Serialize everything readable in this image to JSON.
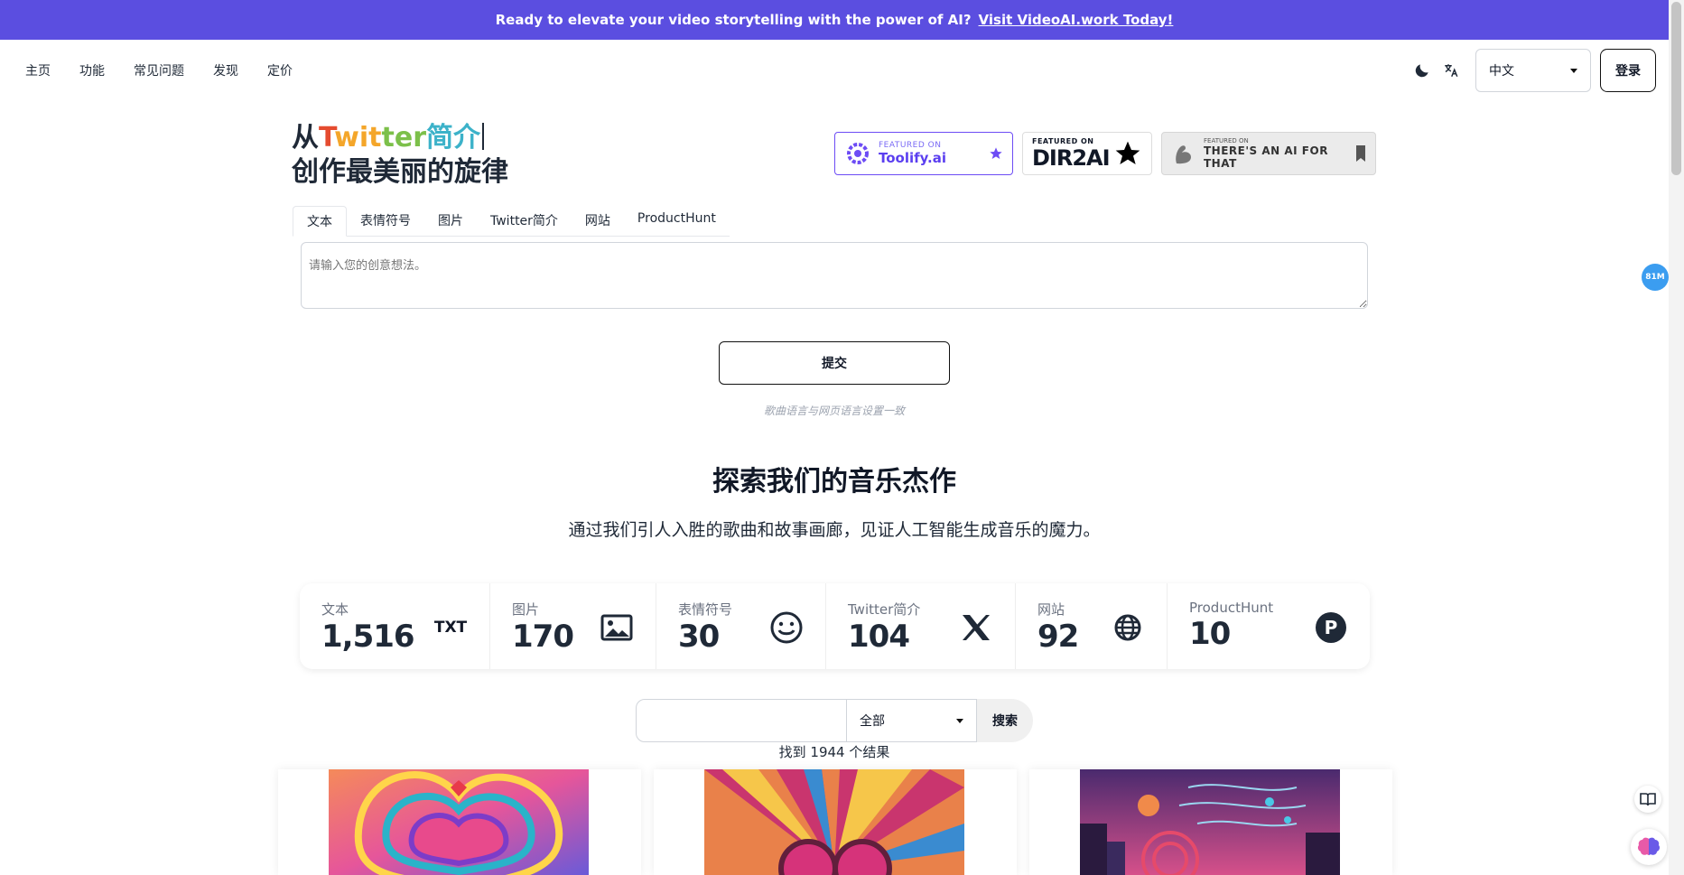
{
  "banner": {
    "text": "Ready to elevate your video storytelling with the power of AI?",
    "link": "Visit VideoAI.work Today!"
  },
  "nav": {
    "links": [
      "主页",
      "功能",
      "常见问题",
      "发现",
      "定价"
    ],
    "language": "中文",
    "login": "登录"
  },
  "hero": {
    "prefix": "从",
    "highlight_parts": [
      "T",
      "wit",
      "ter",
      "简介"
    ],
    "line2": "创作最美丽的旋律"
  },
  "badges": {
    "toolify": {
      "small": "FEATURED ON",
      "big": "Toolify.ai"
    },
    "dir2ai": {
      "small": "FEATURED ON",
      "big": "DIR2AI"
    },
    "theresanai": {
      "small": "FEATURED ON",
      "big": "THERE'S AN AI FOR THAT"
    }
  },
  "tabs": [
    "文本",
    "表情符号",
    "图片",
    "Twitter简介",
    "网站",
    "ProductHunt"
  ],
  "input": {
    "placeholder": "请输入您的创意想法。"
  },
  "submit": "提交",
  "note": "歌曲语言与网页语言设置一致",
  "section": {
    "title": "探索我们的音乐杰作",
    "subtitle": "通过我们引人入胜的歌曲和故事画廊，见证人工智能生成音乐的魔力。"
  },
  "stats": [
    {
      "label": "文本",
      "value": "1,516",
      "icon": "txt-icon"
    },
    {
      "label": "图片",
      "value": "170",
      "icon": "image-icon"
    },
    {
      "label": "表情符号",
      "value": "30",
      "icon": "smiley-icon"
    },
    {
      "label": "Twitter简介",
      "value": "104",
      "icon": "x-icon"
    },
    {
      "label": "网站",
      "value": "92",
      "icon": "globe-icon"
    },
    {
      "label": "ProductHunt",
      "value": "10",
      "icon": "producthunt-icon"
    }
  ],
  "stat_icon_text": {
    "txt": "TXT",
    "p": "P"
  },
  "search": {
    "filter": "全部",
    "button": "搜索",
    "results": "找到 1944 个结果"
  },
  "float_badge": "81M"
}
